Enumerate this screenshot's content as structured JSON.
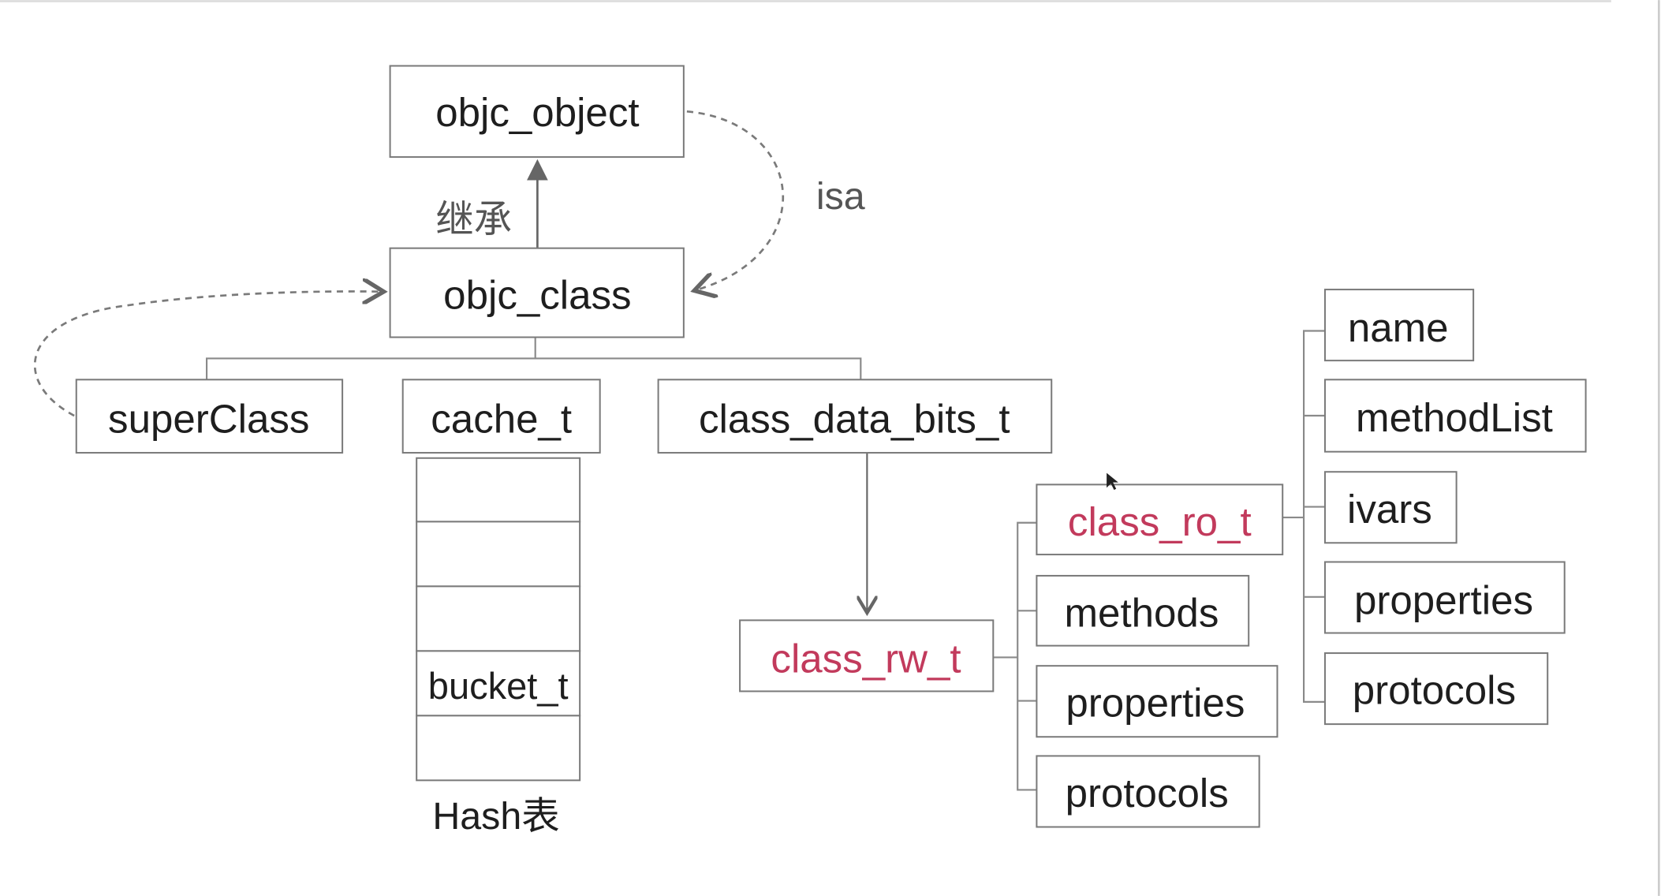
{
  "nodes": {
    "objc_object": "objc_object",
    "objc_class": "objc_class",
    "superClass": "superClass",
    "cache_t": "cache_t",
    "class_data_bits_t": "class_data_bits_t",
    "bucket_t": "bucket_t",
    "class_rw_t": "class_rw_t",
    "class_ro_t": "class_ro_t",
    "rw_methods": "methods",
    "rw_properties": "properties",
    "rw_protocols": "protocols",
    "ro_name": "name",
    "ro_methodList": "methodList",
    "ro_ivars": "ivars",
    "ro_properties": "properties",
    "ro_protocols": "protocols"
  },
  "labels": {
    "inherit": "继承",
    "isa": "isa",
    "hash_table": "Hash表"
  },
  "colors": {
    "highlight": "#c23a5c",
    "border": "#7a7a7a"
  }
}
